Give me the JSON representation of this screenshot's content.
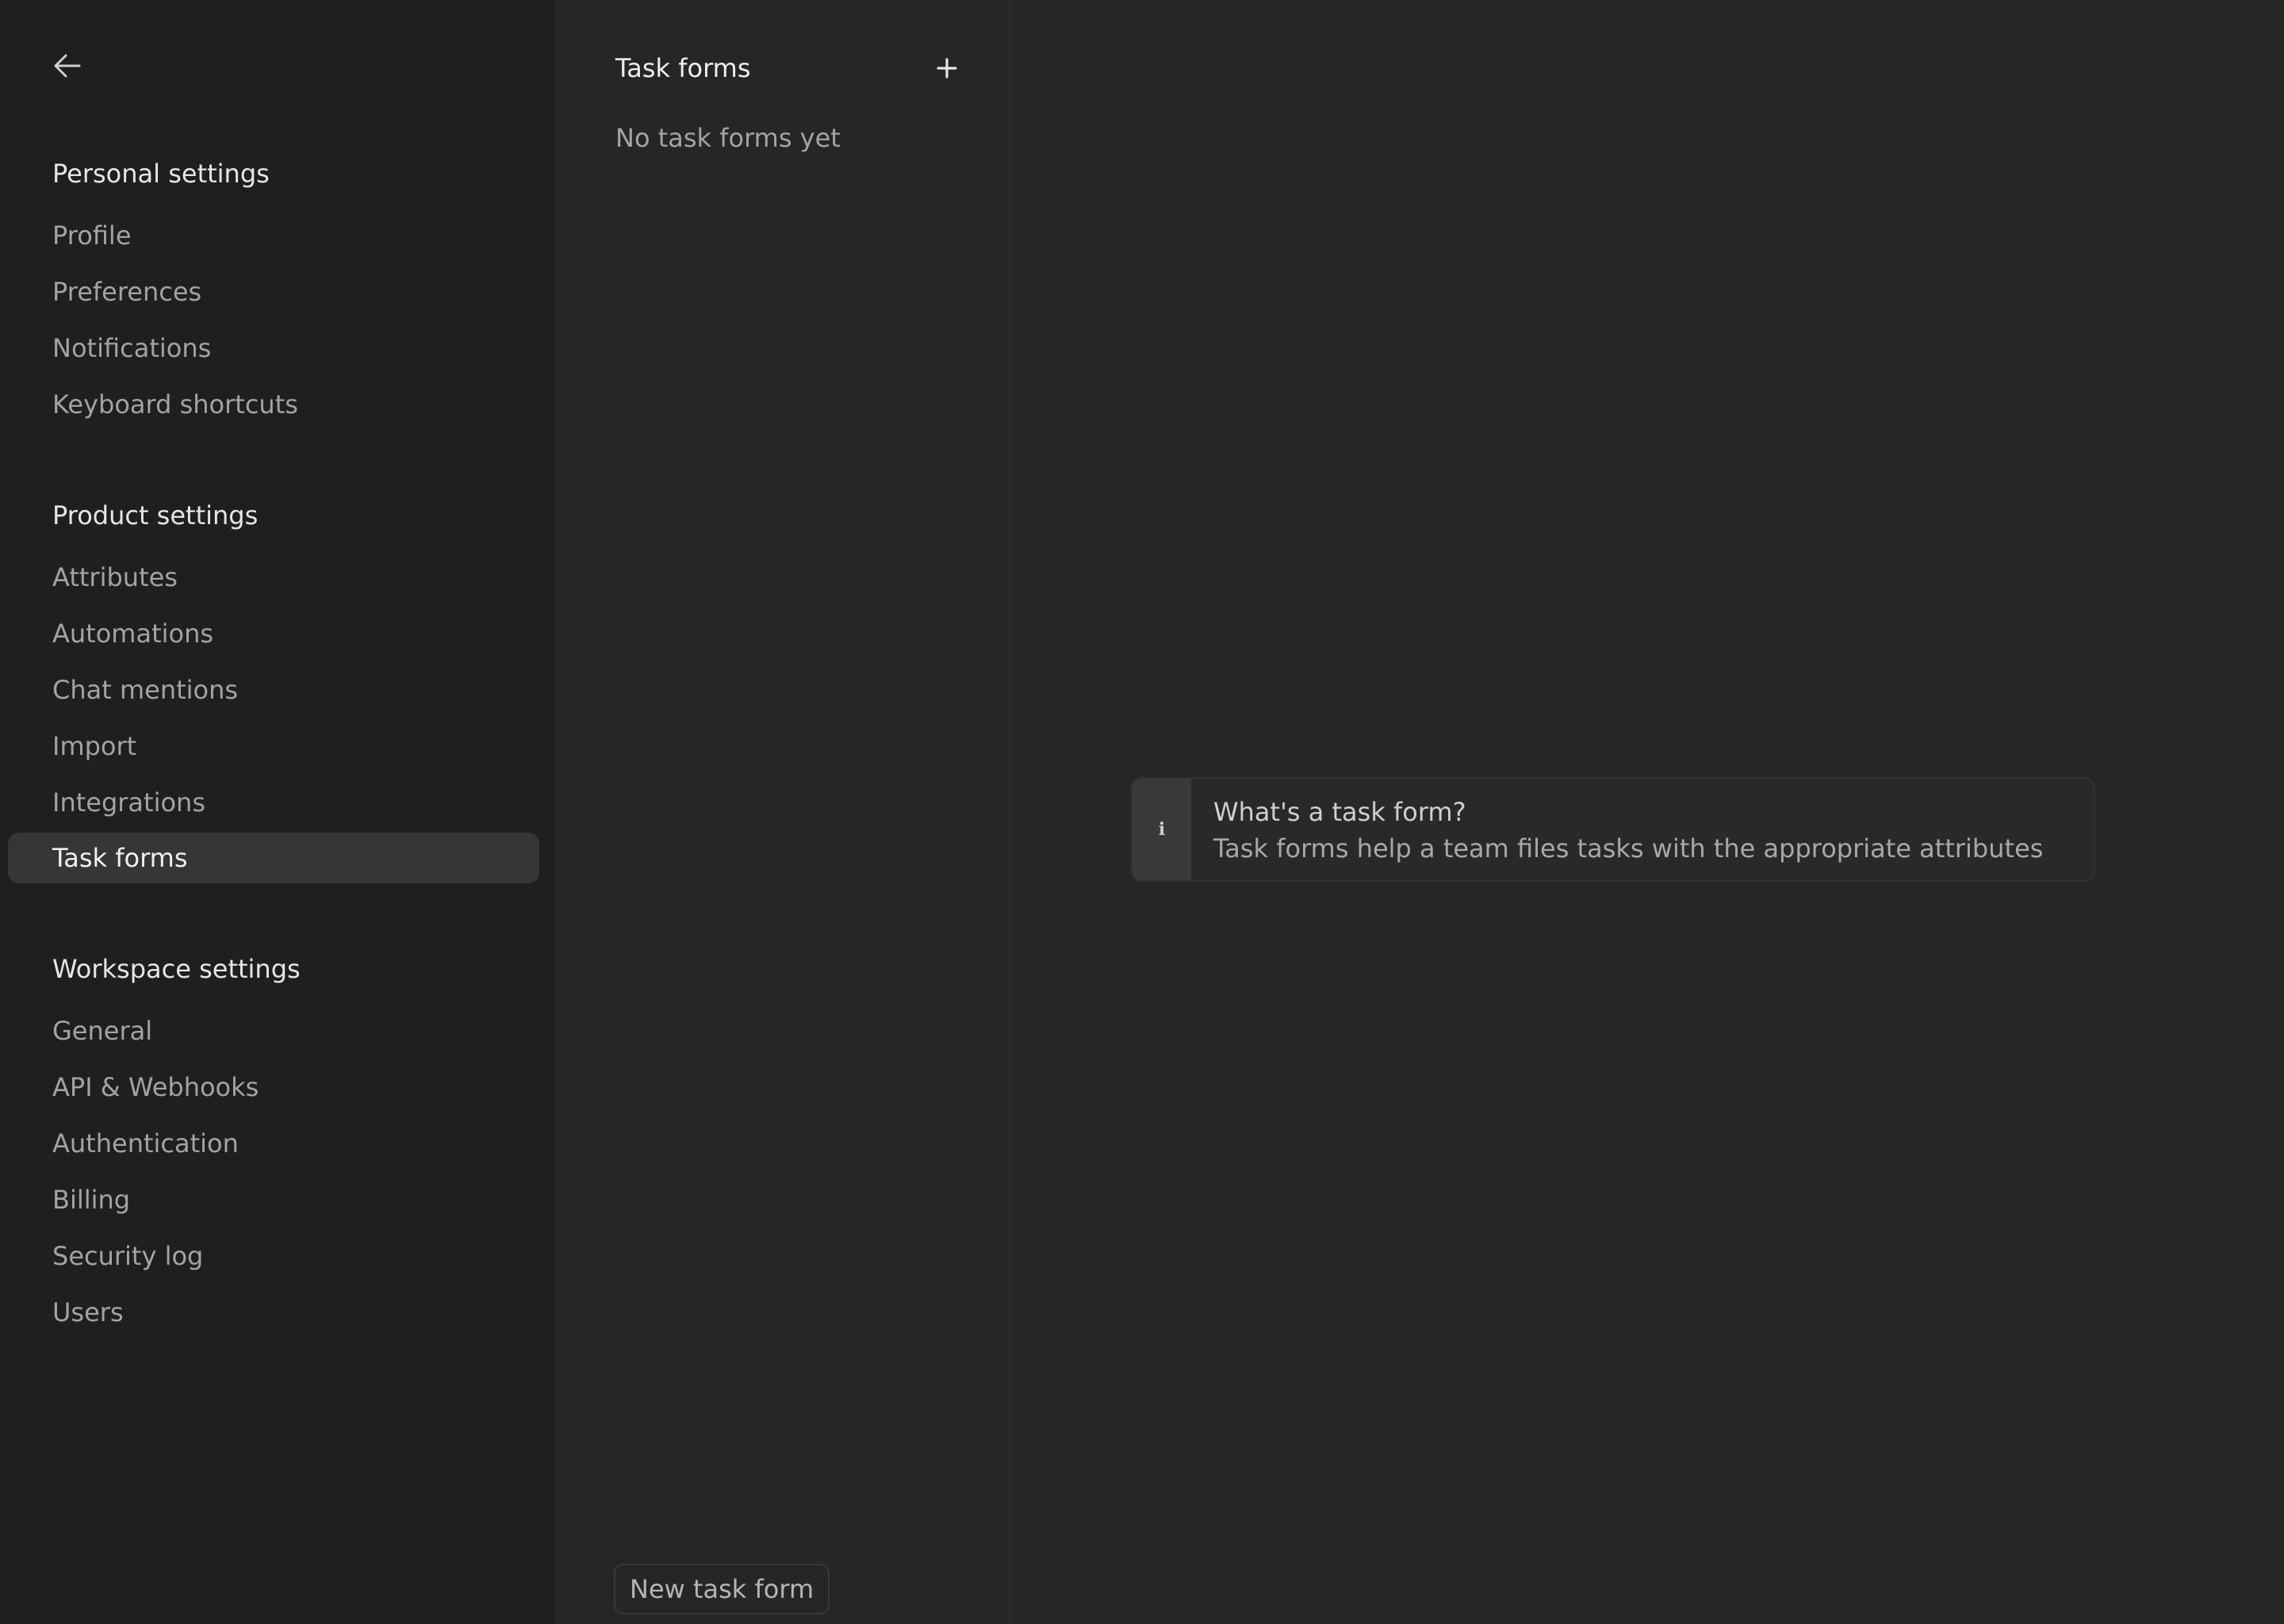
{
  "sidebar": {
    "back_icon": "arrow-left-icon",
    "sections": [
      {
        "title": "Personal settings",
        "items": [
          "Profile",
          "Preferences",
          "Notifications",
          "Keyboard shortcuts"
        ]
      },
      {
        "title": "Product settings",
        "items": [
          "Attributes",
          "Automations",
          "Chat mentions",
          "Import",
          "Integrations",
          "Task forms"
        ]
      },
      {
        "title": "Workspace settings",
        "items": [
          "General",
          "API & Webhooks",
          "Authentication",
          "Billing",
          "Security log",
          "Users"
        ]
      }
    ],
    "active_item": "Task forms"
  },
  "list_pane": {
    "title": "Task forms",
    "add_icon": "plus-icon",
    "empty_text": "No task forms yet",
    "new_button_label": "New task form"
  },
  "info_card": {
    "icon": "info-icon",
    "icon_glyph": "i",
    "title": "What's a task form?",
    "description": "Task forms help a team files tasks with the appropriate attributes"
  },
  "colors": {
    "sidebar_bg": "#1f1f1f",
    "main_bg": "#262626",
    "active_item_bg": "#363636"
  }
}
